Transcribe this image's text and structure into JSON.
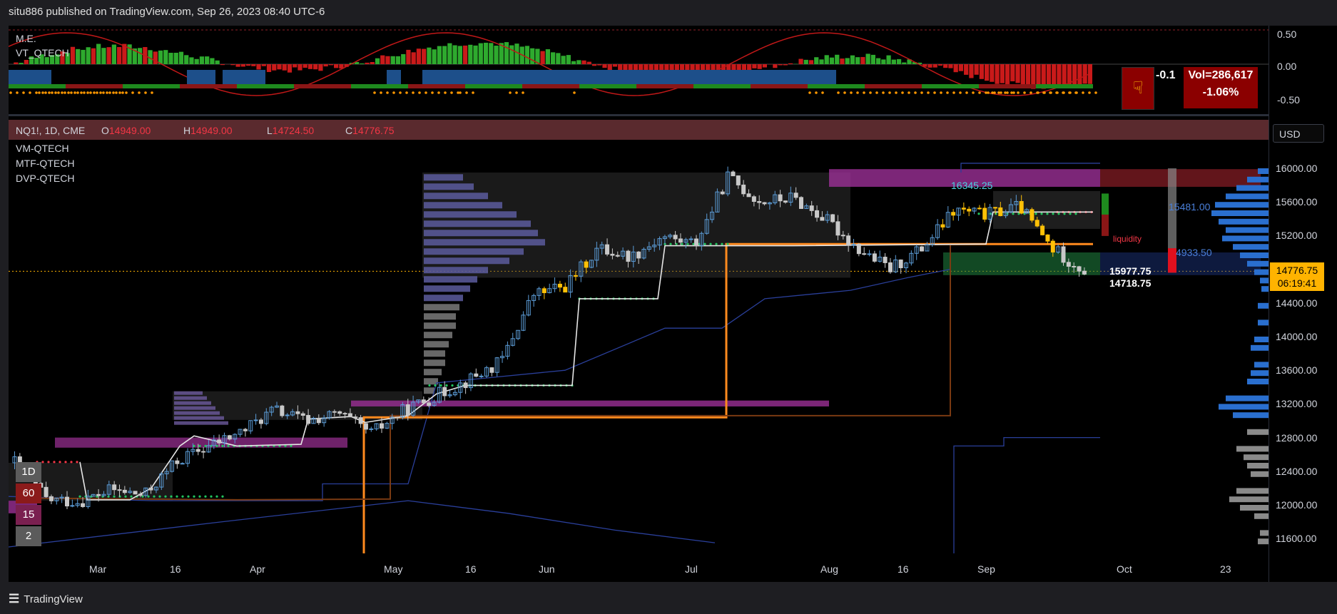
{
  "header": {
    "publish_line": "situ886 published on TradingView.com, Sep 26, 2023 08:40 UTC-6"
  },
  "footer": {
    "brand": "TradingView"
  },
  "indicators": {
    "pane1_labels": [
      "M.E.",
      "VT_QTECH"
    ],
    "main_labels": [
      "VM-QTECH",
      "MTF-QTECH",
      "DVP-QTECH"
    ]
  },
  "ohlc": {
    "symbol": "NQ1!, 1D, CME",
    "o_key": "O",
    "o_val": "14949.00",
    "h_key": "H",
    "h_val": "14949.00",
    "l_key": "L",
    "l_val": "14724.50",
    "c_key": "C",
    "c_val": "14776.75"
  },
  "currency_button": "USD",
  "osc_axis": [
    "0.50",
    "0.00",
    "-0.50"
  ],
  "stats": {
    "arrow": "pointing-hand-icon",
    "value": "-0.1",
    "volume": "Vol=286,617",
    "change": "-1.06%"
  },
  "price_axis": [
    "16000.00",
    "15600.00",
    "15200.00",
    "14800.00",
    "14400.00",
    "14000.00",
    "13600.00",
    "13200.00",
    "12800.00",
    "12400.00",
    "12000.00",
    "11600.00"
  ],
  "time_axis": [
    "Mar",
    "16",
    "Apr",
    "May",
    "16",
    "Jun",
    "Jul",
    "Aug",
    "16",
    "Sep",
    "Oct",
    "23"
  ],
  "current_price": {
    "price": "14776.75",
    "countdown": "06:19:41"
  },
  "timeframe_buttons": [
    "1D",
    "60",
    "15",
    "2"
  ],
  "annotations": {
    "level_1": "16345.25",
    "level_2": "15481.00",
    "level_3": "4933.50",
    "liquidity": "liquidity",
    "level_4": "15977.75",
    "level_5": "14718.75"
  },
  "colors": {
    "up": "#5b9bd5",
    "down": "#c8c8c8",
    "orange": "#ff8a1e",
    "magenta": "#b03aa8",
    "red": "#f23645",
    "green": "#22c55e"
  },
  "chart_data": {
    "type": "candlestick",
    "title": "",
    "ylim": [
      11400,
      16200
    ],
    "close_series": [
      {
        "date": "Feb 20",
        "close": 12510
      },
      {
        "date": "Feb 28",
        "close": 12060
      },
      {
        "date": "Mar 1",
        "close": 12040
      },
      {
        "date": "Mar 8",
        "close": 12180
      },
      {
        "date": "Mar 13",
        "close": 12110
      },
      {
        "date": "Mar 16",
        "close": 12520
      },
      {
        "date": "Mar 20",
        "close": 12700
      },
      {
        "date": "Mar 28",
        "close": 12870
      },
      {
        "date": "Apr 3",
        "close": 13130
      },
      {
        "date": "Apr 12",
        "close": 13000
      },
      {
        "date": "Apr 20",
        "close": 13080
      },
      {
        "date": "Apr 26",
        "close": 12850
      },
      {
        "date": "May 1",
        "close": 13120
      },
      {
        "date": "May 8",
        "close": 13300
      },
      {
        "date": "May 16",
        "close": 13480
      },
      {
        "date": "May 24",
        "close": 13700
      },
      {
        "date": "Jun 1",
        "close": 14500
      },
      {
        "date": "Jun 8",
        "close": 14600
      },
      {
        "date": "Jun 15",
        "close": 15050
      },
      {
        "date": "Jun 22",
        "close": 14950
      },
      {
        "date": "Jun 30",
        "close": 15190
      },
      {
        "date": "Jul 10",
        "close": 15100
      },
      {
        "date": "Jul 18",
        "close": 15900
      },
      {
        "date": "Jul 24",
        "close": 15600
      },
      {
        "date": "Aug 1",
        "close": 15650
      },
      {
        "date": "Aug 8",
        "close": 15400
      },
      {
        "date": "Aug 16",
        "close": 15050
      },
      {
        "date": "Aug 22",
        "close": 14800
      },
      {
        "date": "Aug 28",
        "close": 15050
      },
      {
        "date": "Sep 1",
        "close": 15500
      },
      {
        "date": "Sep 7",
        "close": 15450
      },
      {
        "date": "Sep 14",
        "close": 15550
      },
      {
        "date": "Sep 20",
        "close": 15050
      },
      {
        "date": "Sep 26",
        "close": 14776.75
      }
    ]
  }
}
